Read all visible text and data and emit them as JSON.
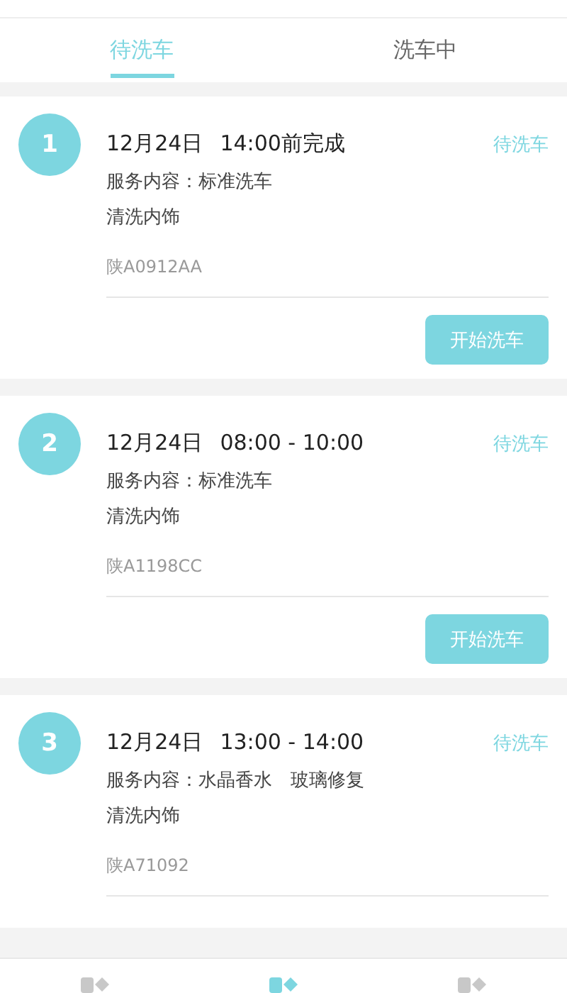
{
  "tabs": [
    {
      "label": "待洗车",
      "selected": true
    },
    {
      "label": "洗车中",
      "selected": false
    }
  ],
  "orders": [
    {
      "number": "1",
      "date": "12月24日",
      "time": "14:00前完成",
      "status": "待洗车",
      "services": "服务内容：标准洗车",
      "extra": "清洗内饰",
      "plate": "陕A0912AA",
      "button": "开始洗车"
    },
    {
      "number": "2",
      "date": "12月24日",
      "time": "08:00 - 10:00",
      "status": "待洗车",
      "services": "服务内容：标准洗车",
      "extra": "清洗内饰",
      "plate": "陕A1198CC",
      "button": "开始洗车"
    },
    {
      "number": "3",
      "date": "12月24日",
      "time": "13:00 - 14:00",
      "status": "待洗车",
      "services": "服务内容：水晶香水　玻璃修复",
      "extra": "清洗内饰",
      "plate": "陕A71092"
    }
  ],
  "bottom_nav": [
    {
      "selected": false
    },
    {
      "selected": true
    },
    {
      "selected": false
    }
  ]
}
